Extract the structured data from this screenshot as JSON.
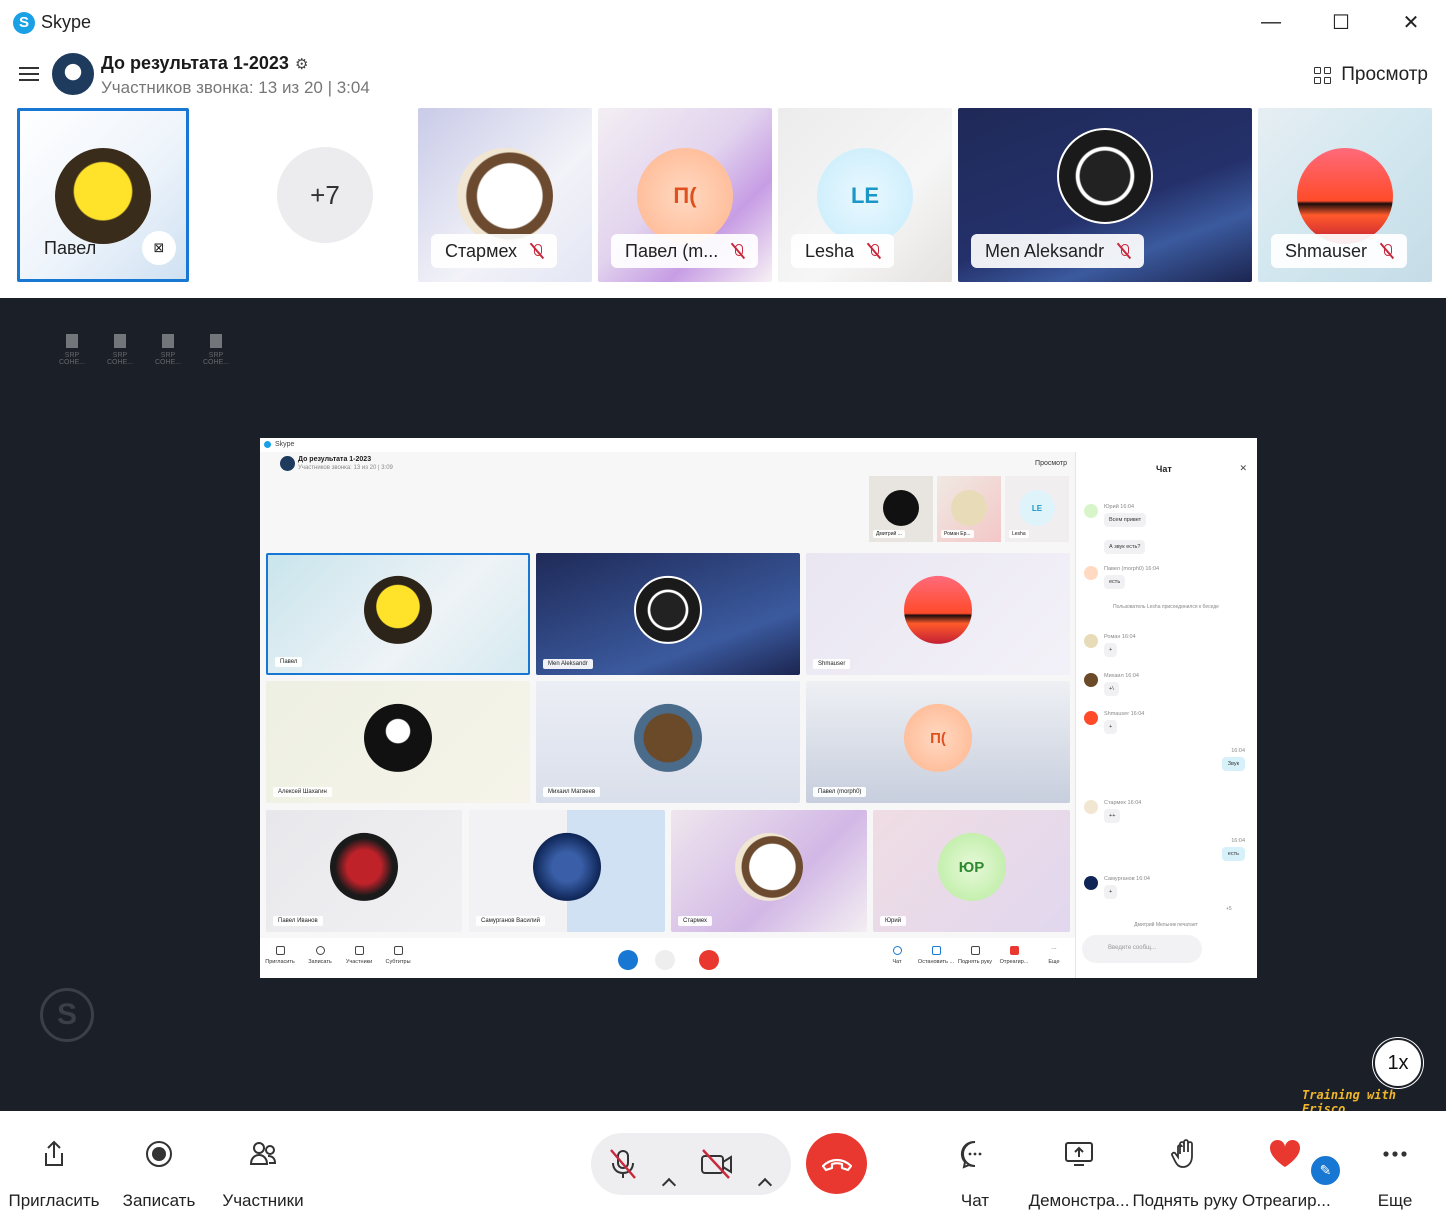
{
  "window": {
    "app_title": "Skype",
    "minimize_glyph": "—",
    "maximize_glyph": "☐",
    "close_glyph": "✕"
  },
  "call_header": {
    "title": "До результата 1-2023",
    "subtitle": "Участников звонка: 13 из 20 | 3:04",
    "view_label": "Просмотр"
  },
  "participants_strip": {
    "self_name": "Павел",
    "more_count": "+7",
    "tiles": [
      {
        "name": "Стармех",
        "initials": "",
        "muted": true
      },
      {
        "name": "Павел (m...",
        "initials": "П(",
        "muted": true
      },
      {
        "name": "Lesha",
        "initials": "LE",
        "muted": true
      },
      {
        "name": "Men Aleksandr",
        "initials": "",
        "muted": true
      },
      {
        "name": "Shmauser",
        "initials": "",
        "muted": true
      }
    ]
  },
  "shared_screen": {
    "app_title": "Skype",
    "header_title": "До результата 1-2023",
    "header_subtitle": "Участников звонка: 13 из 20 | 3:09",
    "view_label": "Просмотр",
    "mini_tiles": [
      "Дмитрий ...",
      "Роман Ер...",
      "Lesha"
    ],
    "mini_initials": "LE",
    "tiles": [
      {
        "name": "Павел",
        "initials": ""
      },
      {
        "name": "Men Aleksandr",
        "initials": ""
      },
      {
        "name": "Shmauser",
        "initials": ""
      },
      {
        "name": "Алексей Шахагин",
        "initials": ""
      },
      {
        "name": "Михаил Матвеев",
        "initials": ""
      },
      {
        "name": "Павел (morph0)",
        "initials": "П("
      },
      {
        "name": "Павел Иванов",
        "initials": ""
      },
      {
        "name": "Самурганов Василий",
        "initials": ""
      },
      {
        "name": "Стармех",
        "initials": ""
      },
      {
        "name": "Юрий",
        "initials": "ЮР"
      }
    ],
    "toolbar": [
      "Пригласить",
      "Записать",
      "Участники",
      "Субтитры",
      "Чат",
      "Остановить ...",
      "Поднять руку",
      "Отреагир...",
      "Еще"
    ],
    "chat": {
      "title": "Чат",
      "messages": [
        {
          "who": "Юрий 16:04",
          "text": "Всем привет"
        },
        {
          "who": "",
          "text": "А звук есть?"
        },
        {
          "who": "Павел (morph0) 16:04",
          "text": "есть"
        },
        {
          "who": "Роман 16:04",
          "text": "+"
        },
        {
          "who": "Михаил 16:04",
          "text": "+\\"
        },
        {
          "who": "Shmauser 16:04",
          "text": "+"
        },
        {
          "who": "Стармех 16:04",
          "text": "++"
        },
        {
          "who": "Самурганов 16:04",
          "text": "+"
        }
      ],
      "system_text": "Пользователь Lesha присоединился к беседе",
      "outgoing": [
        {
          "time": "16:04",
          "text": "Звук"
        },
        {
          "time": "16:04",
          "text": "есть"
        }
      ],
      "reactions_count": "+5",
      "typing_text": "Дмитрий Мельник печатает",
      "input_placeholder": "Введите сообщ..."
    }
  },
  "desktop_files": [
    "SRP COHE...",
    "SRP COHE...",
    "SRP COHE...",
    "SRP COHE..."
  ],
  "speed_label": "1x",
  "watermark": "Training with Frisco",
  "toolbar": {
    "invite": "Пригласить",
    "record": "Записать",
    "participants": "Участники",
    "chat": "Чат",
    "share": "Демонстра...",
    "raise_hand": "Поднять руку",
    "react": "Отреагир...",
    "more": "Еще"
  },
  "colors": {
    "accent": "#1aa1e5",
    "hangup": "#e8382f",
    "muted": "#c8283c",
    "stage_bg": "#1b1f27",
    "selection_border": "#1877d3"
  }
}
